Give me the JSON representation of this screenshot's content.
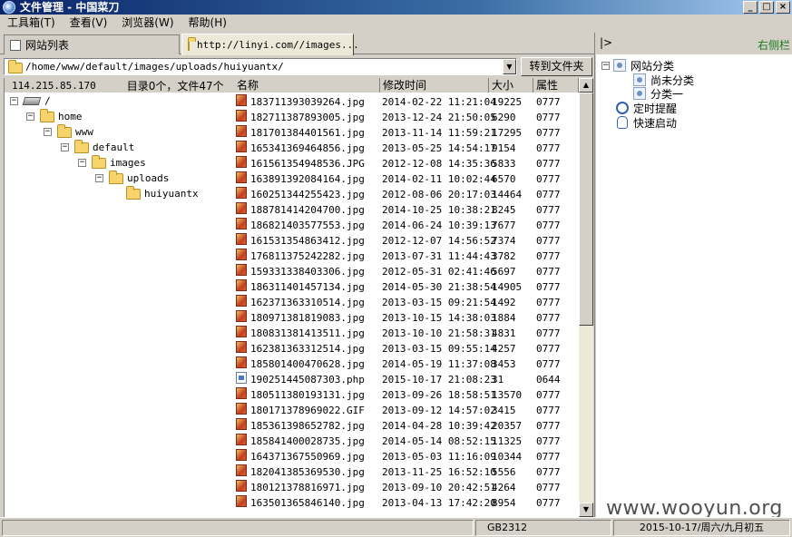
{
  "window": {
    "title": "文件管理 - 中国菜刀",
    "minimize": "_",
    "maximize": "□",
    "close": "×"
  },
  "menu": [
    "工具箱(T)",
    "查看(V)",
    "浏览器(W)",
    "帮助(H)"
  ],
  "tabs": [
    {
      "label": "网站列表",
      "icon": "list-icon"
    },
    {
      "label": "http://linyi.com//images...",
      "icon": "folder-icon"
    }
  ],
  "right_panel": {
    "toggle": "|>",
    "label": "右侧栏"
  },
  "path": {
    "value": "/home/www/default/images/uploads/huiyuantx/",
    "go_button": "转到文件夹"
  },
  "server": {
    "ip": "114.215.85.170",
    "summary": "目录0个，文件47个"
  },
  "tree": [
    {
      "label": "/",
      "expander": "−",
      "icon": "drive"
    },
    {
      "label": "home",
      "expander": "−",
      "icon": "folder"
    },
    {
      "label": "www",
      "expander": "−",
      "icon": "folder"
    },
    {
      "label": "default",
      "expander": "−",
      "icon": "folder"
    },
    {
      "label": "images",
      "expander": "−",
      "icon": "folder"
    },
    {
      "label": "uploads",
      "expander": "−",
      "icon": "folder"
    },
    {
      "label": "huiyuantx",
      "expander": "",
      "icon": "folder"
    }
  ],
  "columns": {
    "name": "名称",
    "mtime": "修改时间",
    "size": "大小",
    "attr": "属性"
  },
  "files": [
    {
      "name": "183711393039264.jpg",
      "mtime": "2014-02-22 11:21:04",
      "size": "19225",
      "attr": "0777",
      "type": "image"
    },
    {
      "name": "182711387893005.jpg",
      "mtime": "2013-12-24 21:50:05",
      "size": "6290",
      "attr": "0777",
      "type": "image"
    },
    {
      "name": "181701384401561.jpg",
      "mtime": "2013-11-14 11:59:21",
      "size": "17295",
      "attr": "0777",
      "type": "image"
    },
    {
      "name": "165341369464856.jpg",
      "mtime": "2013-05-25 14:54:17",
      "size": "9154",
      "attr": "0777",
      "type": "image"
    },
    {
      "name": "161561354948536.JPG",
      "mtime": "2012-12-08 14:35:36",
      "size": "5833",
      "attr": "0777",
      "type": "image"
    },
    {
      "name": "163891392084164.jpg",
      "mtime": "2014-02-11 10:02:44",
      "size": "6570",
      "attr": "0777",
      "type": "image"
    },
    {
      "name": "160251344255423.jpg",
      "mtime": "2012-08-06 20:17:03",
      "size": "14464",
      "attr": "0777",
      "type": "image"
    },
    {
      "name": "188781414204700.jpg",
      "mtime": "2014-10-25 10:38:21",
      "size": "8245",
      "attr": "0777",
      "type": "image"
    },
    {
      "name": "186821403577553.jpg",
      "mtime": "2014-06-24 10:39:13",
      "size": "7677",
      "attr": "0777",
      "type": "image"
    },
    {
      "name": "161531354863412.jpg",
      "mtime": "2012-12-07 14:56:52",
      "size": "7374",
      "attr": "0777",
      "type": "image"
    },
    {
      "name": "176811375242282.jpg",
      "mtime": "2013-07-31 11:44:43",
      "size": "3782",
      "attr": "0777",
      "type": "image"
    },
    {
      "name": "159331338403306.jpg",
      "mtime": "2012-05-31 02:41:46",
      "size": "5697",
      "attr": "0777",
      "type": "image"
    },
    {
      "name": "186311401457134.jpg",
      "mtime": "2014-05-30 21:38:54",
      "size": "14905",
      "attr": "0777",
      "type": "image"
    },
    {
      "name": "162371363310514.jpg",
      "mtime": "2013-03-15 09:21:54",
      "size": "1492",
      "attr": "0777",
      "type": "image"
    },
    {
      "name": "180971381819083.jpg",
      "mtime": "2013-10-15 14:38:03",
      "size": "1884",
      "attr": "0777",
      "type": "image"
    },
    {
      "name": "180831381413511.jpg",
      "mtime": "2013-10-10 21:58:31",
      "size": "4831",
      "attr": "0777",
      "type": "image"
    },
    {
      "name": "162381363312514.jpg",
      "mtime": "2013-03-15 09:55:14",
      "size": "4257",
      "attr": "0777",
      "type": "image"
    },
    {
      "name": "185801400470628.jpg",
      "mtime": "2014-05-19 11:37:08",
      "size": "3453",
      "attr": "0777",
      "type": "image"
    },
    {
      "name": "190251445087303.php",
      "mtime": "2015-10-17 21:08:23",
      "size": "31",
      "attr": "0644",
      "type": "php"
    },
    {
      "name": "180511380193131.jpg",
      "mtime": "2013-09-26 18:58:51",
      "size": "13570",
      "attr": "0777",
      "type": "image"
    },
    {
      "name": "180171378969022.GIF",
      "mtime": "2013-09-12 14:57:02",
      "size": "3415",
      "attr": "0777",
      "type": "image"
    },
    {
      "name": "185361398652782.jpg",
      "mtime": "2014-04-28 10:39:42",
      "size": "20357",
      "attr": "0777",
      "type": "image"
    },
    {
      "name": "185841400028735.jpg",
      "mtime": "2014-05-14 08:52:15",
      "size": "11325",
      "attr": "0777",
      "type": "image"
    },
    {
      "name": "164371367550969.jpg",
      "mtime": "2013-05-03 11:16:09",
      "size": "10344",
      "attr": "0777",
      "type": "image"
    },
    {
      "name": "182041385369530.jpg",
      "mtime": "2013-11-25 16:52:10",
      "size": "5556",
      "attr": "0777",
      "type": "image"
    },
    {
      "name": "180121378816971.jpg",
      "mtime": "2013-09-10 20:42:51",
      "size": "4264",
      "attr": "0777",
      "type": "image"
    },
    {
      "name": "163501365846140.jpg",
      "mtime": "2013-04-13 17:42:20",
      "size": "8954",
      "attr": "0777",
      "type": "image"
    }
  ],
  "categories": {
    "root": "网站分类",
    "children": [
      "尚未分类",
      "分类一"
    ],
    "reminder": "定时提醒",
    "quickstart": "快速启动"
  },
  "status": {
    "encoding": "GB2312",
    "date": "2015-10-17/周六/九月初五"
  },
  "watermark": "www.wooyun.org"
}
